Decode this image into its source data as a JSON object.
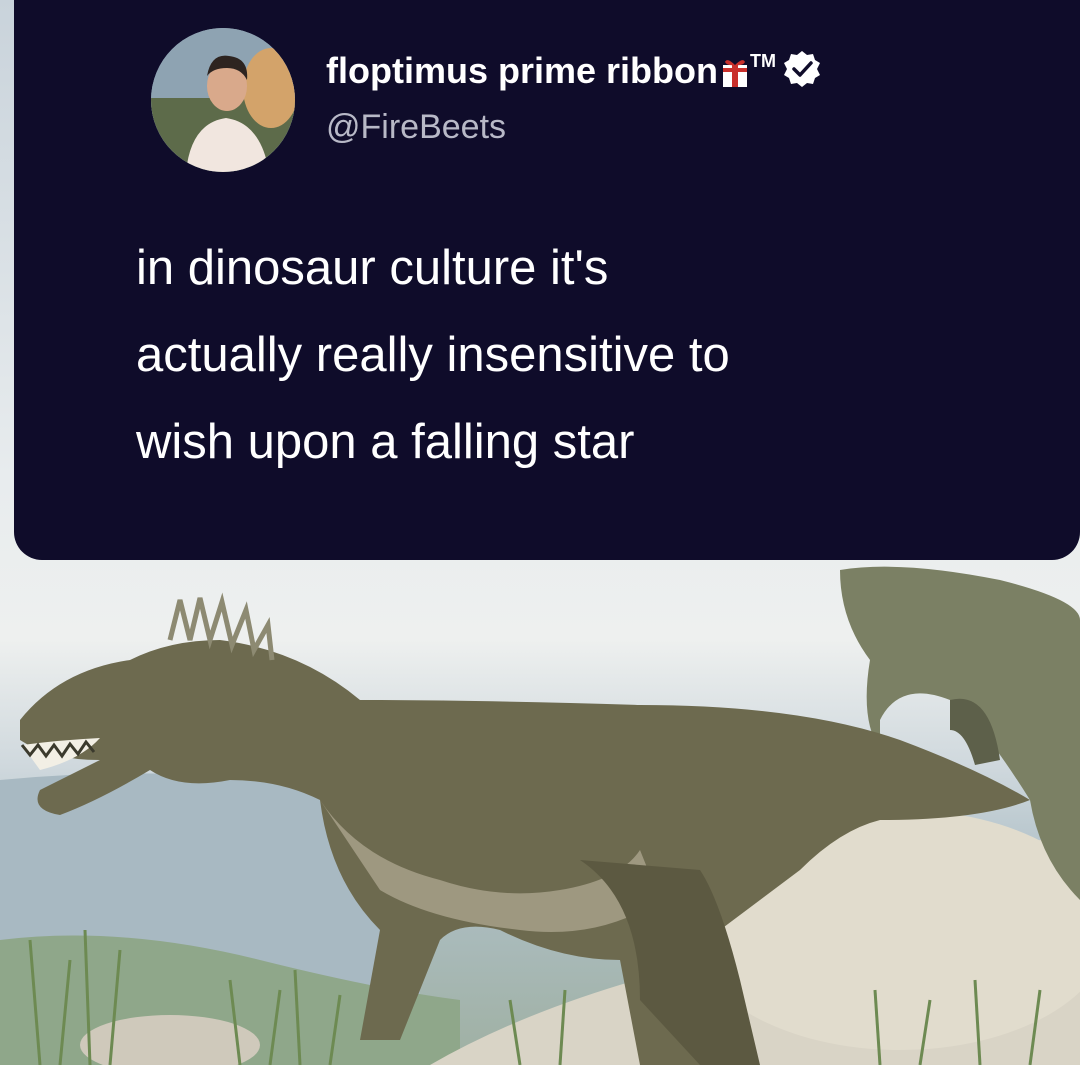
{
  "tweet": {
    "display_name": "floptimus prime ribbon",
    "trademark": "TM",
    "handle": "@FireBeets",
    "text_lines": [
      "in dinosaur culture it's",
      "actually really insensitive to",
      "wish upon a falling star"
    ]
  },
  "icons": {
    "gift": "gift-ribbon-icon",
    "verified": "verified-badge-icon"
  },
  "colors": {
    "card_background": "#0f0c2a",
    "text": "#ffffff",
    "handle_text": "#b8b9c7",
    "gift_red": "#c9302c"
  }
}
